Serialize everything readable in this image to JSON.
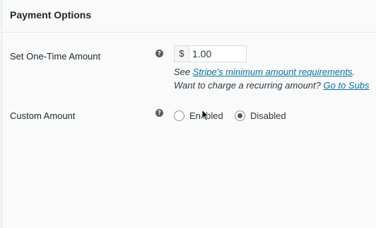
{
  "section": {
    "title": "Payment Options"
  },
  "one_time": {
    "label": "Set One-Time Amount",
    "help_icon": "question-circle-icon",
    "currency_symbol": "$",
    "value": "1.00",
    "desc_prefix": "See ",
    "desc_link": "Stripe's minimum amount requirements",
    "desc_suffix": ".",
    "recurring_prefix": "Want to charge a recurring amount? ",
    "recurring_link": "Go to Subs"
  },
  "custom_amount": {
    "label": "Custom Amount",
    "help_icon": "question-circle-icon",
    "options": [
      {
        "label": "Enabled",
        "selected": false
      },
      {
        "label": "Disabled",
        "selected": true
      }
    ]
  },
  "colors": {
    "link": "#0073aa",
    "text": "#23282d"
  }
}
